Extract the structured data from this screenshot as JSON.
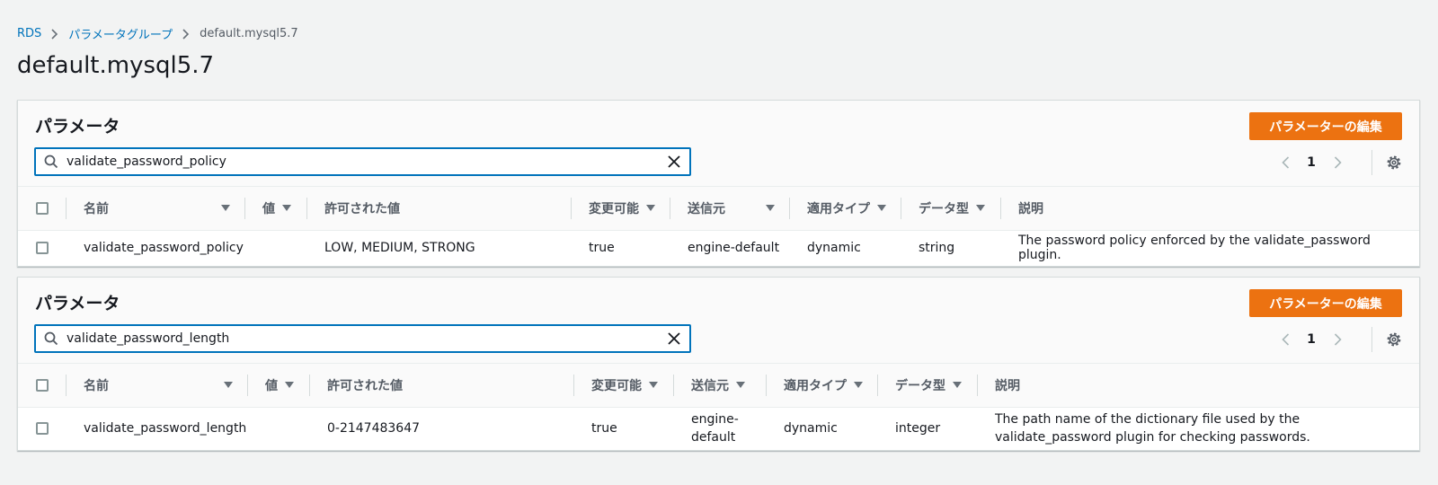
{
  "breadcrumb": {
    "items": [
      "RDS",
      "パラメータグループ"
    ],
    "current": "default.mysql5.7"
  },
  "page_title": "default.mysql5.7",
  "panels": [
    {
      "title": "パラメータ",
      "edit_label": "パラメーターの編集",
      "search_value": "validate_password_policy",
      "page": "1",
      "columns": [
        "名前",
        "値",
        "許可された値",
        "変更可能",
        "送信元",
        "適用タイプ",
        "データ型",
        "説明"
      ],
      "row": {
        "name": "validate_password_policy",
        "value": "",
        "allowed": "LOW, MEDIUM, STRONG",
        "modifiable": "true",
        "source": "engine-default",
        "apply_type": "dynamic",
        "data_type": "string",
        "description": "The password policy enforced by the validate_password plugin."
      }
    },
    {
      "title": "パラメータ",
      "edit_label": "パラメーターの編集",
      "search_value": "validate_password_length",
      "page": "1",
      "columns": [
        "名前",
        "値",
        "許可された値",
        "変更可能",
        "送信元",
        "適用タイプ",
        "データ型",
        "説明"
      ],
      "row": {
        "name": "validate_password_length",
        "value": "",
        "allowed": "0-2147483647",
        "modifiable": "true",
        "source": "engine-default",
        "apply_type": "dynamic",
        "data_type": "integer",
        "description": "The path name of the dictionary file used by the validate_password plugin for checking passwords."
      }
    }
  ],
  "colors": {
    "accent": "#ec7211",
    "link": "#0073bb",
    "background": "#f2f3f3"
  },
  "icons": [
    "chevron-right-icon",
    "search-icon",
    "close-icon",
    "chevron-left-icon",
    "gear-icon",
    "caret-down-icon"
  ]
}
